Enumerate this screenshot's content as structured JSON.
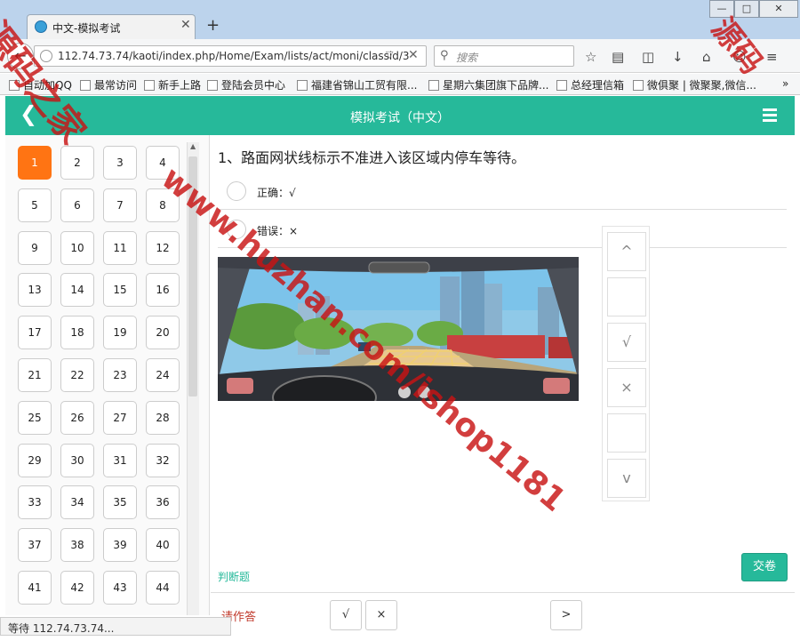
{
  "browser": {
    "tab_title": "中文-模拟考试",
    "url": "112.74.73.74/kaoti/index.php/Home/Exam/lists/act/moni/classid/3",
    "search_placeholder": "搜索",
    "window_controls": {
      "minimize": "—",
      "maximize": "□",
      "close": "✕"
    },
    "bookmarks": [
      "自动加QQ",
      "最常访问",
      "新手上路",
      "登陆会员中心",
      "福建省锦山工贸有限...",
      "星期六集团旗下品牌...",
      "总经理信箱",
      "微俱聚 | 微聚聚,微信...",
      "»"
    ]
  },
  "header": {
    "title": "模拟考试（中文）"
  },
  "question_nav": {
    "numbers": [
      "1",
      "2",
      "3",
      "4",
      "5",
      "6",
      "7",
      "8",
      "9",
      "10",
      "11",
      "12",
      "13",
      "14",
      "15",
      "16",
      "17",
      "18",
      "19",
      "20",
      "21",
      "22",
      "23",
      "24",
      "25",
      "26",
      "27",
      "28",
      "29",
      "30",
      "31",
      "32",
      "33",
      "34",
      "35",
      "36",
      "37",
      "38",
      "39",
      "40",
      "41",
      "42",
      "43",
      "44"
    ],
    "active": "1"
  },
  "question": {
    "text": "1、路面网状线标示不准进入该区域内停车等待。",
    "options": [
      {
        "label": "正确：√"
      },
      {
        "label": "错误：×"
      }
    ],
    "type_label": "判断题"
  },
  "side_tools": [
    "^",
    "",
    "√",
    "×",
    "",
    "v"
  ],
  "submit_label": "交卷",
  "bottom": {
    "prompt": "请作答",
    "true_btn": "√",
    "false_btn": "×",
    "next_btn": ">"
  },
  "status_text": "等待 112.74.73.74...",
  "watermarks": [
    "源码之家",
    "www.huzhan.com/ishop1181",
    "源码"
  ],
  "colors": {
    "accent": "#26b99a",
    "active_number": "#ff7413",
    "watermark": "#c81414",
    "prompt": "#c0392b"
  }
}
